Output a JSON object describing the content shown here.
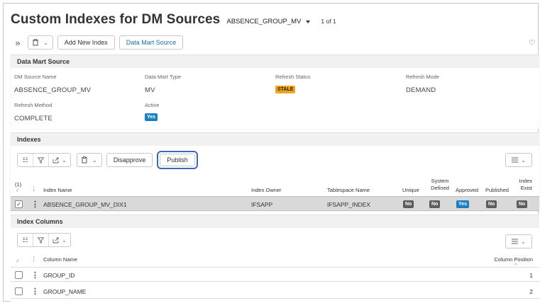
{
  "page": {
    "title": "Custom Indexes for DM Sources",
    "source_selector": "ABSENCE_GROUP_MV",
    "record_count": "1 of 1"
  },
  "toolbar": {
    "add_new_index": "Add New Index",
    "data_mart_source": "Data Mart Source"
  },
  "dm_section": {
    "title": "Data Mart Source",
    "fields": [
      {
        "label": "DM Source Name",
        "value": "ABSENCE_GROUP_MV"
      },
      {
        "label": "Data Mart Type",
        "value": "MV"
      },
      {
        "label": "Refresh Status",
        "value": "STALE"
      },
      {
        "label": "Refresh Mode",
        "value": "DEMAND"
      },
      {
        "label": "Refresh Method",
        "value": "COMPLETE"
      },
      {
        "label": "Active",
        "value": "Yes"
      }
    ]
  },
  "indexes": {
    "title": "Indexes",
    "disapprove": "Disapprove",
    "publish": "Publish",
    "selection_count": "(1)",
    "columns": {
      "index_name": "Index Name",
      "index_owner": "Index Owner",
      "tablespace_name": "Tablespace Name",
      "unique": "Unique",
      "system_defined": "System Defined",
      "approved": "Approved",
      "published": "Published",
      "index_exist": "Index Exist"
    },
    "rows": [
      {
        "index_name": "ABSENCE_GROUP_MV_DIX1",
        "index_owner": "IFSAPP",
        "tablespace_name": "IFSAPP_INDEX",
        "unique": "No",
        "system_defined": "No",
        "approved": "Yes",
        "published": "No",
        "index_exist": "No"
      }
    ]
  },
  "index_columns": {
    "title": "Index Columns",
    "columns": {
      "column_name": "Column Name",
      "column_position": "Column Position"
    },
    "rows": [
      {
        "column_name": "GROUP_ID",
        "column_position": "1"
      },
      {
        "column_name": "GROUP_NAME",
        "column_position": "2"
      }
    ]
  },
  "colors": {
    "stale": "#f0a41c",
    "yes": "#1a7fc0",
    "no": "#5c5c5c",
    "publish_highlight": "#3f67b8"
  }
}
